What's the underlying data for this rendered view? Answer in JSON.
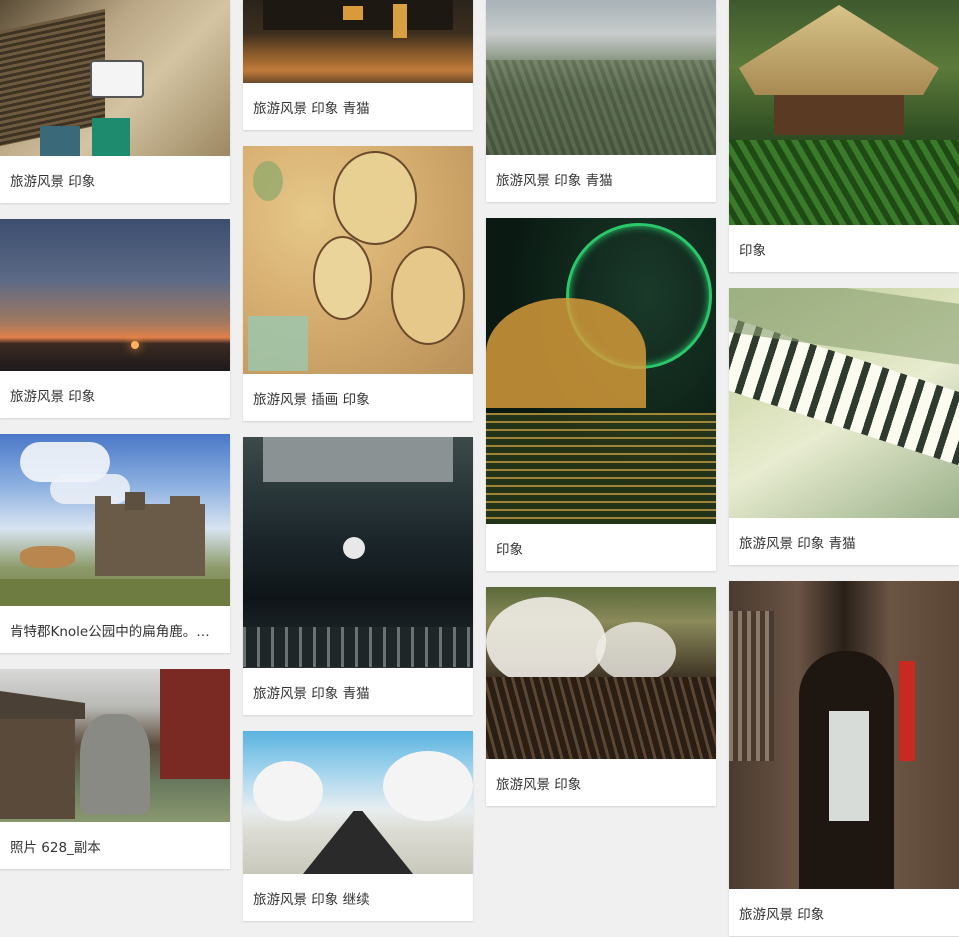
{
  "cards": [
    {
      "caption": "旅游风景 印象",
      "art": "street-sign-photo"
    },
    {
      "caption": "旅游风景 印象",
      "art": "sunset-photo"
    },
    {
      "caption": "肯特郡Knole公园中的扁角鹿。类似的…",
      "art": "deer-castle-photo"
    },
    {
      "caption": "照片 628_副本",
      "art": "canal-lion-photo"
    },
    {
      "caption": "旅游风景 印象 青猫",
      "art": "subway-station-photo"
    },
    {
      "caption": "旅游风景 插画 印象",
      "art": "illustrated-map"
    },
    {
      "caption": "旅游风景 印象 青猫",
      "art": "reflection-photo"
    },
    {
      "caption": "旅游风景 印象 继续",
      "art": "snow-road-photo"
    },
    {
      "caption": "旅游风景 印象 青猫",
      "art": "foggy-field-photo"
    },
    {
      "caption": "印象",
      "art": "ferris-wheel-photo"
    },
    {
      "caption": "旅游风景 印象",
      "art": "reeds-photo"
    },
    {
      "caption": "印象",
      "art": "pavilion-photo"
    },
    {
      "caption": "旅游风景 印象 青猫",
      "art": "piano-photo"
    },
    {
      "caption": "旅游风景 印象",
      "art": "alley-photo"
    }
  ]
}
